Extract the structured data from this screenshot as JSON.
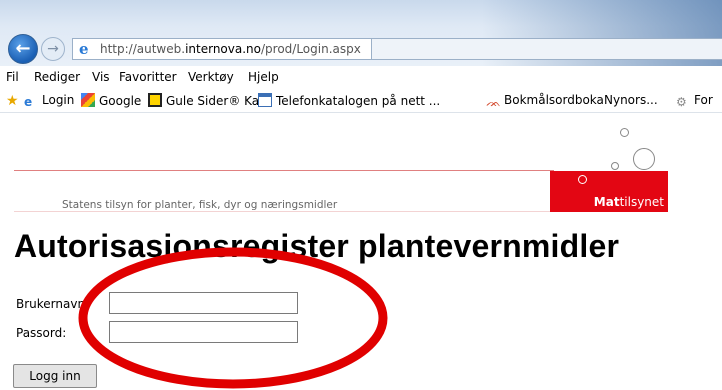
{
  "browser": {
    "url_prefix": "http://autweb.",
    "url_domain": "internova.no",
    "url_path": "/prod/Login.aspx",
    "menu": [
      "Fil",
      "Rediger",
      "Vis",
      "Favoritter",
      "Verktøy",
      "Hjelp"
    ],
    "favorites": [
      "Login",
      "Google",
      "Gule Sider® Kart",
      "Telefonkatalogen på nett ...",
      "Bokmålsordboka",
      "Nynors...",
      "For"
    ]
  },
  "page": {
    "tagline": "Statens tilsyn for planter, fisk, dyr og næringsmidler",
    "brand_bold": "Mat",
    "brand_rest": "tilsynet",
    "title": "Autorisasjonsregister plantevernmidler",
    "username_label": "Brukernavn:",
    "username_value": "",
    "password_label": "Passord:",
    "password_value": "",
    "login_button": "Logg inn"
  },
  "colors": {
    "brand_red": "#e30613",
    "annotation_red": "#e00000"
  }
}
